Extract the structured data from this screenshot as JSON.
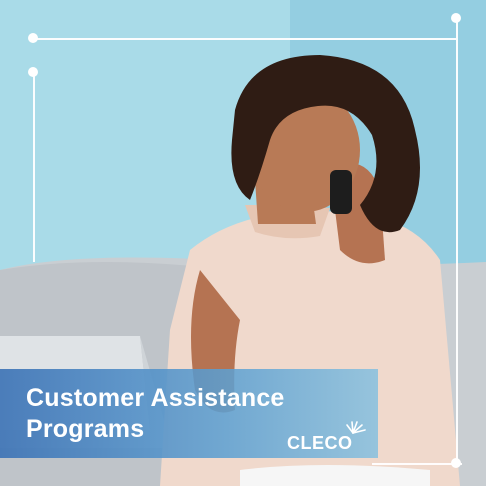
{
  "promo": {
    "title_line1": "Customer Assistance",
    "title_line2": "Programs"
  },
  "brand": {
    "name": "CLECO"
  },
  "colors": {
    "banner": "#3E74B6",
    "accent_light": "#7FBFD6",
    "text": "#FFFFFF"
  }
}
